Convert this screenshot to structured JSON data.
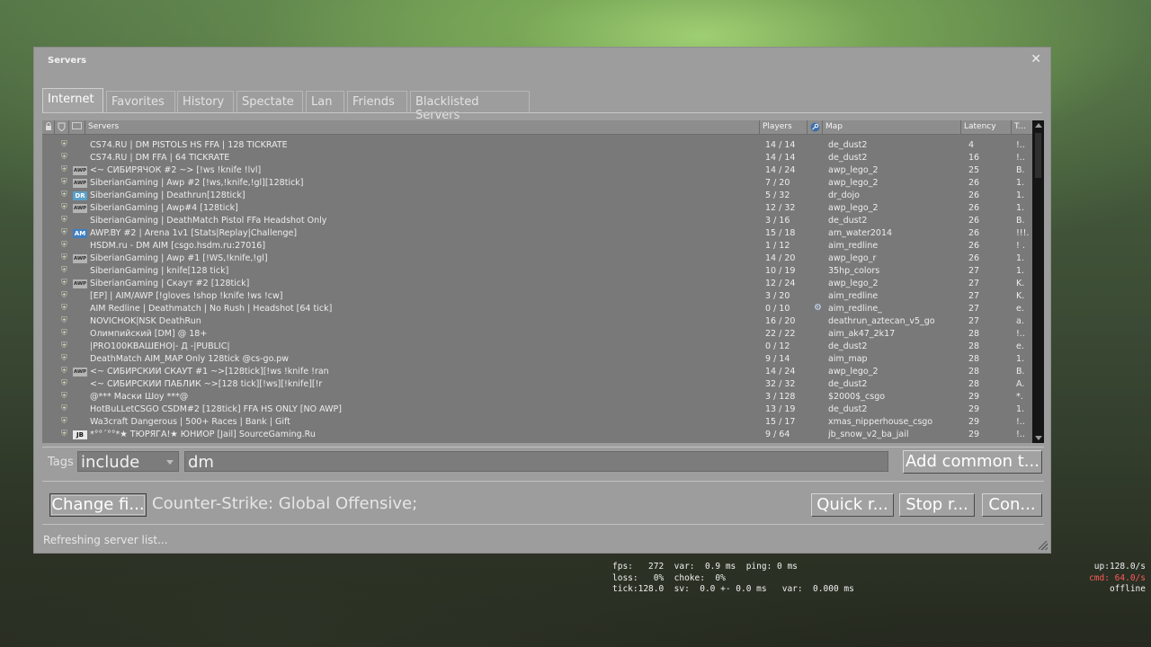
{
  "window": {
    "title": "Servers",
    "close_glyph": "✕"
  },
  "tabs": [
    {
      "label": "Internet",
      "active": true
    },
    {
      "label": "Favorites"
    },
    {
      "label": "History"
    },
    {
      "label": "Spectate"
    },
    {
      "label": "Lan"
    },
    {
      "label": "Friends"
    },
    {
      "label": "Blacklisted Servers"
    }
  ],
  "columns": {
    "password": "lock-icon",
    "vac": "vac-shield-icon",
    "icon": "server-icon",
    "servers": "Servers",
    "players": "Players",
    "bots": "steam-icon",
    "map": "Map",
    "latency": "Latency",
    "tags": "T..."
  },
  "icon_labels": {
    "awp": "AWP",
    "dr": "DR",
    "am": "AM",
    "jb": "JB"
  },
  "servers": [
    {
      "name": "CS74.RU | DM PISTOLS HS FFA | 128 TICKRATE",
      "players": "14 / 14",
      "map": "de_dust2",
      "latency": "4",
      "tags": "!..",
      "icon": ""
    },
    {
      "name": "CS74.RU | DM FFA | 64 TICKRATE",
      "players": "14 / 14",
      "map": "de_dust2",
      "latency": "16",
      "tags": "!..",
      "icon": ""
    },
    {
      "name": "<~ СИБИРЯЧОК #2 ~> [!ws !knife !lvl]",
      "players": "14 / 24",
      "map": "awp_lego_2",
      "latency": "25",
      "tags": "B.",
      "icon": "awp"
    },
    {
      "name": "SiberianGaming | Awp #2 [!ws,!knife,!gl][128tick]",
      "players": "7 / 20",
      "map": "awp_lego_2",
      "latency": "26",
      "tags": "1.",
      "icon": "awp"
    },
    {
      "name": "SiberianGaming | Deathrun[128tick]",
      "players": "5 / 32",
      "map": "dr_dojo",
      "latency": "26",
      "tags": "1.",
      "icon": "dr"
    },
    {
      "name": "SiberianGaming | Awp#4 [128tick]",
      "players": "12 / 32",
      "map": "awp_lego_2",
      "latency": "26",
      "tags": "1.",
      "icon": "awp"
    },
    {
      "name": "SiberianGaming | DeathMatch Pistol FFa Headshot Only",
      "players": "3 / 16",
      "map": "de_dust2",
      "latency": "26",
      "tags": "B.",
      "icon": ""
    },
    {
      "name": "AWP.BY #2 | Arena 1v1 [Stats|Replay|Challenge]",
      "players": "15 / 18",
      "map": "am_water2014",
      "latency": "26",
      "tags": "!!!.",
      "icon": "am"
    },
    {
      "name": "HSDM.ru - DM AIM [csgo.hsdm.ru:27016]",
      "players": "1 / 12",
      "map": "aim_redline",
      "latency": "26",
      "tags": "! .",
      "icon": ""
    },
    {
      "name": "SiberianGaming | Awp #1 [!WS,!knife,!gl]",
      "players": "14 / 20",
      "map": "awp_lego_r",
      "latency": "26",
      "tags": "1.",
      "icon": "awp"
    },
    {
      "name": "SiberianGaming | knife[128 tick]",
      "players": "10 / 19",
      "map": "35hp_colors",
      "latency": "27",
      "tags": "1.",
      "icon": ""
    },
    {
      "name": "SiberianGaming | Скаут #2 [128tick]",
      "players": "12 / 24",
      "map": "awp_lego_2",
      "latency": "27",
      "tags": "K.",
      "icon": "awp"
    },
    {
      "name": "[EP] | AIM/AWP [!gloves !shop !knife !ws !cw]",
      "players": "3 / 20",
      "map": "aim_redline",
      "latency": "27",
      "tags": "K.",
      "icon": ""
    },
    {
      "name": "AIM Redline | Deathmatch | No Rush | Headshot [64 tick]",
      "players": "0 / 10",
      "map": "aim_redline_",
      "latency": "27",
      "tags": "e.",
      "icon": "",
      "steam": true
    },
    {
      "name": "NOVICHOK|NSK DeathRun",
      "players": "16 / 20",
      "map": "deathrun_aztecan_v5_go",
      "latency": "27",
      "tags": "a.",
      "icon": ""
    },
    {
      "name": "Олимпийский [DM] @ 18+",
      "players": "22 / 22",
      "map": "aim_ak47_2k17",
      "latency": "28",
      "tags": "!..",
      "icon": ""
    },
    {
      "name": "|PRO100КВАШЕНО|- Д -|PUBLIC|",
      "players": "0 / 12",
      "map": "de_dust2",
      "latency": "28",
      "tags": "e.",
      "icon": ""
    },
    {
      "name": "DeathMatch AIM_MAP Only 128tick @cs-go.pw",
      "players": "9 / 14",
      "map": "aim_map",
      "latency": "28",
      "tags": "1.",
      "icon": ""
    },
    {
      "name": "<~ СИБИРСКИЙ СКАУТ #1 ~>[128tick][!ws !knife !ran",
      "players": "14 / 24",
      "map": "awp_lego_2",
      "latency": "28",
      "tags": "B.",
      "icon": "awp"
    },
    {
      "name": "<~ СИБИРСКИЙ ПАБЛИК ~>[128 tick][!ws][!knife][!r",
      "players": "32 / 32",
      "map": "de_dust2",
      "latency": "28",
      "tags": "A.",
      "icon": ""
    },
    {
      "name": "@*** Маски Шоу ***@",
      "players": "3 / 128",
      "map": "$2000$_csgo",
      "latency": "29",
      "tags": "*.",
      "icon": ""
    },
    {
      "name": "HotBuLLetCSGO CSDM#2 [128tick] FFA HS ONLY [NO AWP]",
      "players": "13 / 19",
      "map": "de_dust2",
      "latency": "29",
      "tags": "1.",
      "icon": ""
    },
    {
      "name": "Wa3craft Dangerous | 500+ Races | Bank | Gift",
      "players": "15 / 17",
      "map": "xmas_nipperhouse_csgo",
      "latency": "29",
      "tags": "!..",
      "icon": ""
    },
    {
      "name": "*°°´°°*★ ТЮРЯГА!★ ЮНИОР [Jail] SourceGaming.Ru",
      "players": "9 / 64",
      "map": "jb_snow_v2_ba_jail",
      "latency": "29",
      "tags": "!..",
      "icon": "jb"
    }
  ],
  "filters": {
    "tags_label": "Tags",
    "tags_mode": "include",
    "tags_value": "dm",
    "add_common_label": "Add common t...",
    "change_filters_label": "Change fi...",
    "game_label": "Counter-Strike: Global Offensive;",
    "quick_refresh_label": "Quick r...",
    "stop_refresh_label": "Stop r...",
    "connect_label": "Con..."
  },
  "status": "Refreshing server list...",
  "netgraph": {
    "line1": "fps:   272  var:  0.9 ms  ping: 0 ms",
    "line2": "loss:   0%  choke:  0%",
    "line3": "tick:128.0  sv:  0.0 +- 0.0 ms   var:  0.000 ms",
    "up": "up:128.0/s",
    "cmd": "cmd: 64.0/s",
    "offline": "offline"
  },
  "colors": {
    "window_bg": "#9d9d9d",
    "list_bg": "#797979",
    "cmd_red": "#ff5a5a",
    "shield_green": "#c9d6b6"
  }
}
